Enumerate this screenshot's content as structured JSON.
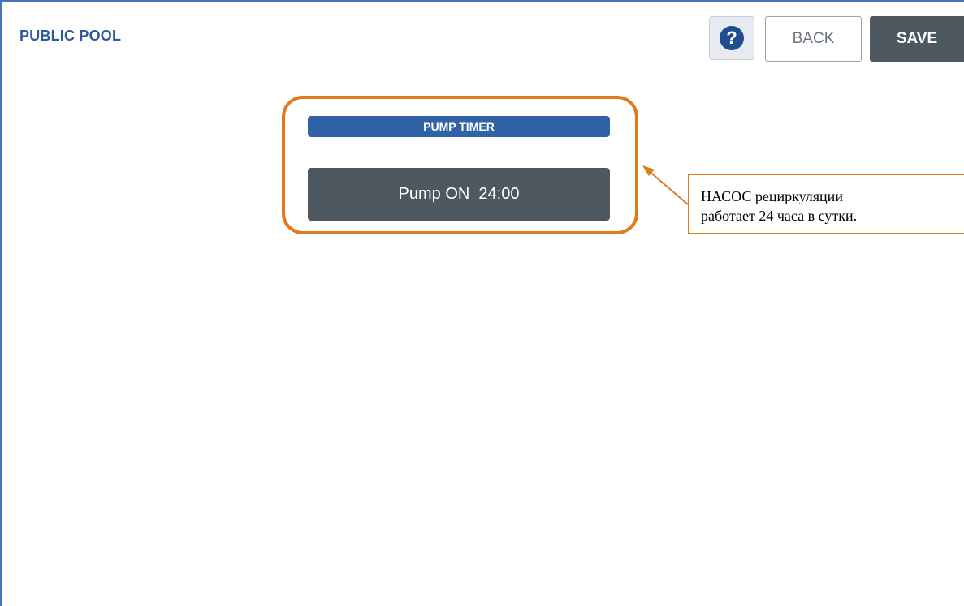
{
  "header": {
    "title": "PUBLIC POOL",
    "help_icon": "?",
    "back_label": "BACK",
    "save_label": "SAVE"
  },
  "pump_timer": {
    "header": "PUMP TIMER",
    "button_label": "Pump ON  24:00"
  },
  "callout": {
    "line1": "НАСОС рециркуляции",
    "line2": "работает 24 часа в сутки."
  },
  "colors": {
    "accent_blue": "#2f62a6",
    "dark_button": "#4e5861",
    "highlight_orange": "#e07a1a"
  }
}
